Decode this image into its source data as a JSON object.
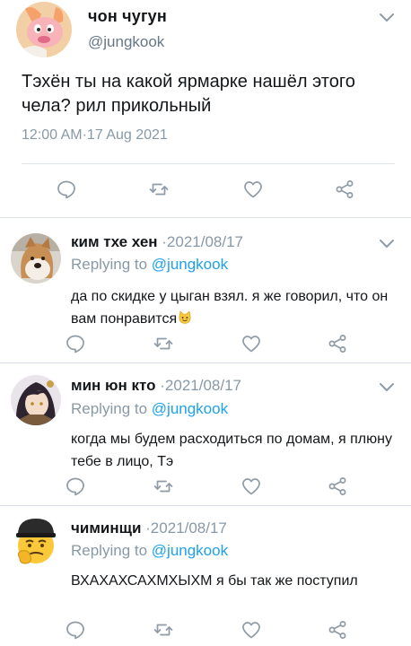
{
  "main_tweet": {
    "author_name": "чон чугун",
    "author_handle": "@jungkook",
    "text": "Тэхён ты на какой ярмарке нашёл этого чела? рил прикольный",
    "timestamp": "12:00 AM·17 Aug 2021"
  },
  "replies": [
    {
      "name": "ким тхе хен",
      "date": " ·2021/08/17",
      "replying_prefix": "Replying to ",
      "replying_handle": "@jungkook",
      "text": "да по скидке у цыган взял. я же говорил, что он вам понравится",
      "emoji": "cat-face-emoji"
    },
    {
      "name": "мин юн кто",
      "date": " ·2021/08/17",
      "replying_prefix": "Replying to ",
      "replying_handle": "@jungkook",
      "text": "когда мы будем расходиться по домам, я плюну тебе в лицо, Тэ"
    },
    {
      "name": "чиминщи",
      "date": " ·2021/08/17",
      "replying_prefix": "Replying to ",
      "replying_handle": "@jungkook",
      "text": "ВХАХАХСАХМХЫХМ я бы так же поступил"
    }
  ],
  "colors": {
    "handle_blue": "#1da1f2",
    "muted_gray": "#8899a6",
    "icon_gray": "#8f9ba6",
    "text": "#14171a"
  },
  "icons": {
    "actions": [
      "reply-icon",
      "retweet-icon",
      "like-icon",
      "share-icon"
    ],
    "menu": "chevron-down-icon"
  }
}
